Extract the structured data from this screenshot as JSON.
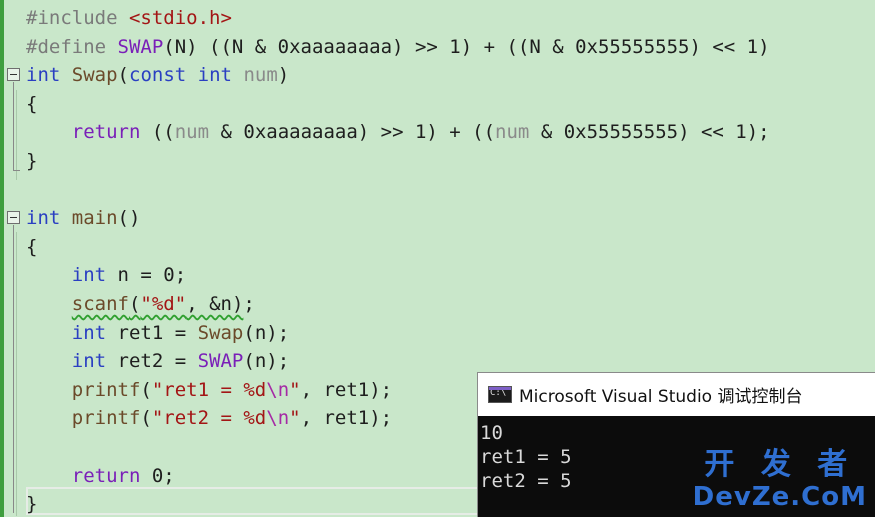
{
  "editor": {
    "lines": [
      {
        "tokens": [
          {
            "t": "#include ",
            "c": "pp"
          },
          {
            "t": "<stdio.h>",
            "c": "str"
          }
        ]
      },
      {
        "tokens": [
          {
            "t": "#define ",
            "c": "pp"
          },
          {
            "t": "SWAP",
            "c": "mac"
          },
          {
            "t": "(N) ((N & 0xaaaaaaaa) >> 1) + ((N & 0x55555555) << 1)",
            "c": ""
          }
        ]
      },
      {
        "tokens": [
          {
            "t": "int",
            "c": "k"
          },
          {
            "t": " ",
            "c": ""
          },
          {
            "t": "Swap",
            "c": "fn"
          },
          {
            "t": "(",
            "c": ""
          },
          {
            "t": "const",
            "c": "k"
          },
          {
            "t": " ",
            "c": ""
          },
          {
            "t": "int",
            "c": "k"
          },
          {
            "t": " ",
            "c": ""
          },
          {
            "t": "num",
            "c": "par"
          },
          {
            "t": ")",
            "c": ""
          }
        ]
      },
      {
        "tokens": [
          {
            "t": "{",
            "c": ""
          }
        ]
      },
      {
        "tokens": [
          {
            "t": "    ",
            "c": ""
          },
          {
            "t": "return",
            "c": "mac"
          },
          {
            "t": " ((",
            "c": ""
          },
          {
            "t": "num",
            "c": "par"
          },
          {
            "t": " & 0xaaaaaaaa) >> 1) + ((",
            "c": ""
          },
          {
            "t": "num",
            "c": "par"
          },
          {
            "t": " & 0x55555555) << 1);",
            "c": ""
          }
        ]
      },
      {
        "tokens": [
          {
            "t": "}",
            "c": ""
          }
        ]
      },
      {
        "tokens": []
      },
      {
        "tokens": [
          {
            "t": "int",
            "c": "k"
          },
          {
            "t": " ",
            "c": ""
          },
          {
            "t": "main",
            "c": "fn"
          },
          {
            "t": "()",
            "c": ""
          }
        ]
      },
      {
        "tokens": [
          {
            "t": "{",
            "c": ""
          }
        ]
      },
      {
        "tokens": [
          {
            "t": "    ",
            "c": ""
          },
          {
            "t": "int",
            "c": "k"
          },
          {
            "t": " n = 0;",
            "c": ""
          }
        ]
      },
      {
        "tokens": [
          {
            "t": "    ",
            "c": ""
          },
          {
            "t": "scanf",
            "c": "fn squiggle"
          },
          {
            "t": "(",
            "c": "squiggle"
          },
          {
            "t": "\"%d\"",
            "c": "str squiggle"
          },
          {
            "t": ", &n)",
            "c": "squiggle"
          },
          {
            "t": ";",
            "c": ""
          }
        ]
      },
      {
        "tokens": [
          {
            "t": "    ",
            "c": ""
          },
          {
            "t": "int",
            "c": "k"
          },
          {
            "t": " ret1 = ",
            "c": ""
          },
          {
            "t": "Swap",
            "c": "fn"
          },
          {
            "t": "(n);",
            "c": ""
          }
        ]
      },
      {
        "tokens": [
          {
            "t": "    ",
            "c": ""
          },
          {
            "t": "int",
            "c": "k"
          },
          {
            "t": " ret2 = ",
            "c": ""
          },
          {
            "t": "SWAP",
            "c": "mac"
          },
          {
            "t": "(n);",
            "c": ""
          }
        ]
      },
      {
        "tokens": [
          {
            "t": "    ",
            "c": ""
          },
          {
            "t": "printf",
            "c": "fn"
          },
          {
            "t": "(",
            "c": ""
          },
          {
            "t": "\"ret1 = %d",
            "c": "str"
          },
          {
            "t": "\\n",
            "c": "esc"
          },
          {
            "t": "\"",
            "c": "str"
          },
          {
            "t": ", ret1);",
            "c": ""
          }
        ]
      },
      {
        "tokens": [
          {
            "t": "    ",
            "c": ""
          },
          {
            "t": "printf",
            "c": "fn"
          },
          {
            "t": "(",
            "c": ""
          },
          {
            "t": "\"ret2 = %d",
            "c": "str"
          },
          {
            "t": "\\n",
            "c": "esc"
          },
          {
            "t": "\"",
            "c": "str"
          },
          {
            "t": ", ret1);",
            "c": ""
          }
        ]
      },
      {
        "tokens": []
      },
      {
        "tokens": [
          {
            "t": "    ",
            "c": ""
          },
          {
            "t": "return",
            "c": "mac"
          },
          {
            "t": " 0;",
            "c": ""
          }
        ]
      },
      {
        "tokens": [
          {
            "t": "}",
            "c": ""
          }
        ]
      }
    ]
  },
  "console": {
    "title": "Microsoft Visual Studio 调试控制台",
    "icon": "console-window-icon",
    "output": [
      "10",
      "ret1 = 5",
      "ret2 = 5"
    ]
  },
  "watermark": {
    "top": "开 发 者",
    "bottom": "DevZe.CoM"
  },
  "colors": {
    "background": "#c9e7ca",
    "keyword": "#2a3fc2",
    "string": "#a31515",
    "macro": "#7a1fb8"
  }
}
